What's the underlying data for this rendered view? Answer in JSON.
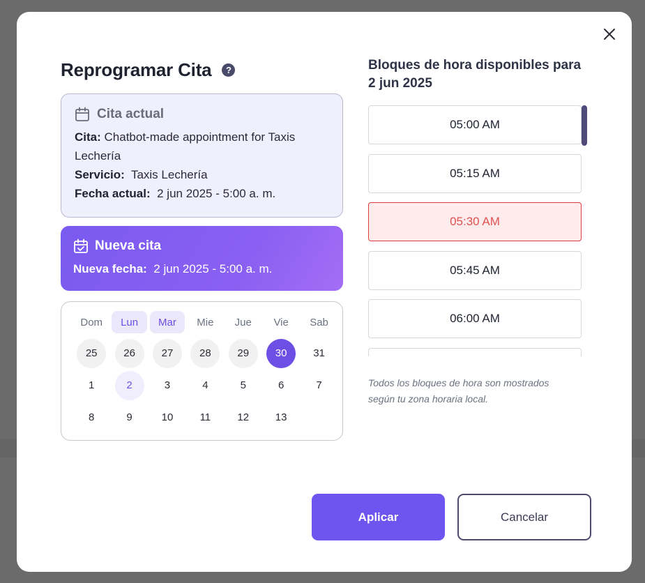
{
  "modal": {
    "title": "Reprogramar Cita",
    "help_icon": "?"
  },
  "current_appointment": {
    "heading": "Cita actual",
    "icon": "calendar-icon",
    "cita_label": "Cita:",
    "cita_value": "Chatbot-made appointment for Taxis Lechería",
    "servicio_label": "Servicio:",
    "servicio_value": "Taxis Lechería",
    "fecha_label": "Fecha actual:",
    "fecha_value": "2 jun 2025 - 5:00 a. m."
  },
  "new_appointment": {
    "heading": "Nueva cita",
    "icon": "calendar-check-icon",
    "fecha_label": "Nueva fecha:",
    "fecha_value": "2 jun 2025 - 5:00 a. m."
  },
  "calendar": {
    "weekdays": [
      "Dom",
      "Lun",
      "Mar",
      "Mie",
      "Jue",
      "Vie",
      "Sab"
    ],
    "rows": [
      [
        "25",
        "26",
        "27",
        "28",
        "29",
        "30",
        "31"
      ],
      [
        "1",
        "2",
        "3",
        "4",
        "5",
        "6",
        "7"
      ],
      [
        "8",
        "9",
        "10",
        "11",
        "12",
        "13",
        ""
      ]
    ]
  },
  "slots": {
    "title": "Bloques de hora disponibles para 2 jun 2025",
    "items": [
      "05:00 AM",
      "05:15 AM",
      "05:30 AM",
      "05:45 AM",
      "06:00 AM",
      ""
    ],
    "note": "Todos los bloques de hora son mostrados según tu zona horaria local."
  },
  "actions": {
    "apply": "Aplicar",
    "cancel": "Cancelar"
  },
  "colors": {
    "accent": "#6f55ef",
    "taken_slot": "#e23b3b"
  }
}
